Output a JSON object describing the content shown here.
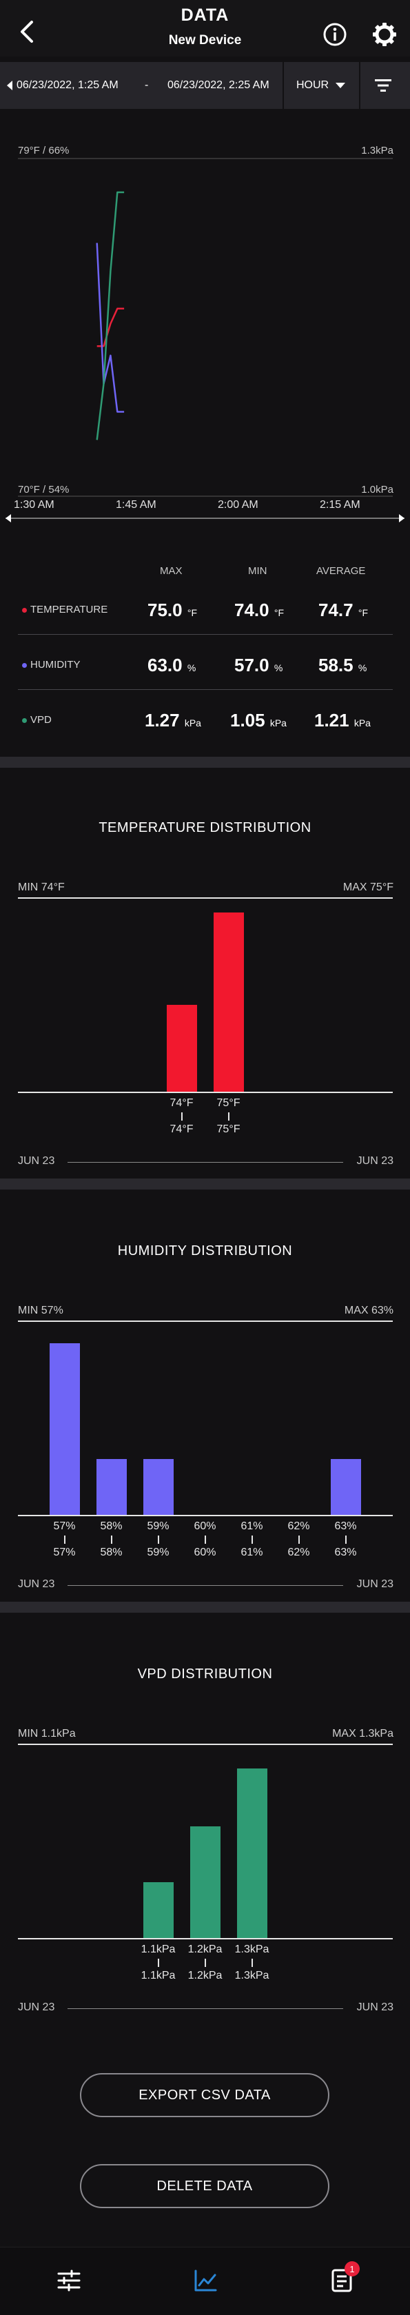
{
  "header": {
    "title": "DATA",
    "subtitle": "New Device",
    "back_icon": "chevron-left-icon",
    "info_icon": "info-icon",
    "settings_icon": "gear-icon"
  },
  "range": {
    "start": "06/23/2022, 1:25 AM",
    "dash": "-",
    "end": "06/23/2022, 2:25 AM",
    "unit": "HOUR"
  },
  "chart": {
    "left_top": "79°F / 66%",
    "left_bottom": "70°F / 54%",
    "right_top": "1.3kPa",
    "right_bottom": "1.0kPa",
    "time_labels": [
      "1:30 AM",
      "1:45 AM",
      "2:00 AM",
      "2:15 AM"
    ]
  },
  "chart_data": {
    "type": "line",
    "x_ticks": [
      "1:30 AM",
      "1:45 AM",
      "2:00 AM",
      "2:15 AM"
    ],
    "left_axis": {
      "top": "79°F / 66%",
      "bottom": "70°F / 54%"
    },
    "right_axis": {
      "top": "1.3kPa",
      "bottom": "1.0kPa"
    },
    "series": [
      {
        "name": "TEMPERATURE",
        "color": "#e8213a",
        "x": [
          "1:40 AM",
          "1:41 AM",
          "1:42 AM",
          "1:43 AM",
          "1:44 AM"
        ],
        "y": [
          74.0,
          74.0,
          74.6,
          75.0,
          75.0
        ]
      },
      {
        "name": "HUMIDITY",
        "color": "#6f65f6",
        "x": [
          "1:40 AM",
          "1:41 AM",
          "1:42 AM",
          "1:43 AM",
          "1:44 AM"
        ],
        "y": [
          63.0,
          58.0,
          59.0,
          57.0,
          57.0
        ]
      },
      {
        "name": "VPD",
        "color": "#2f9b74",
        "x": [
          "1:40 AM",
          "1:41 AM",
          "1:42 AM",
          "1:43 AM",
          "1:44 AM"
        ],
        "y": [
          1.05,
          1.1,
          1.2,
          1.27,
          1.27
        ]
      }
    ]
  },
  "stats": {
    "headers": {
      "max": "MAX",
      "min": "MIN",
      "avg": "AVERAGE"
    },
    "rows": [
      {
        "label": "TEMPERATURE",
        "color": "#e8213a",
        "max": "75.0",
        "min": "74.0",
        "avg": "74.7",
        "unit": "°F"
      },
      {
        "label": "HUMIDITY",
        "color": "#6f65f6",
        "max": "63.0",
        "min": "57.0",
        "avg": "58.5",
        "unit": "%"
      },
      {
        "label": "VPD",
        "color": "#2f9b74",
        "max": "1.27",
        "min": "1.05",
        "avg": "1.21",
        "unit": "kPa"
      }
    ]
  },
  "distributions": [
    {
      "title": "TEMPERATURE DISTRIBUTION",
      "min": "MIN 74°F",
      "max": "MAX 75°F",
      "color": "#f2182e",
      "bins": [
        {
          "top": "74°F",
          "bottom": "74°F",
          "value": 0.45
        },
        {
          "top": "75°F",
          "bottom": "75°F",
          "value": 0.93
        }
      ],
      "date_start": "JUN 23",
      "date_end": "JUN 23"
    },
    {
      "title": "HUMIDITY DISTRIBUTION",
      "min": "MIN 57%",
      "max": "MAX 63%",
      "color": "#6f65f6",
      "bins": [
        {
          "top": "57%",
          "bottom": "57%",
          "value": 0.89
        },
        {
          "top": "58%",
          "bottom": "58%",
          "value": 0.29
        },
        {
          "top": "59%",
          "bottom": "59%",
          "value": 0.29
        },
        {
          "top": "60%",
          "bottom": "60%",
          "value": 0
        },
        {
          "top": "61%",
          "bottom": "61%",
          "value": 0
        },
        {
          "top": "62%",
          "bottom": "62%",
          "value": 0
        },
        {
          "top": "63%",
          "bottom": "63%",
          "value": 0.29
        }
      ],
      "date_start": "JUN 23",
      "date_end": "JUN 23"
    },
    {
      "title": "VPD DISTRIBUTION",
      "min": "MIN 1.1kPa",
      "max": "MAX 1.3kPa",
      "color": "#2f9b74",
      "bins": [
        {
          "top": "1.1kPa",
          "bottom": "1.1kPa",
          "value": 0.29
        },
        {
          "top": "1.2kPa",
          "bottom": "1.2kPa",
          "value": 0.58
        },
        {
          "top": "1.3kPa",
          "bottom": "1.3kPa",
          "value": 0.88
        }
      ],
      "date_start": "JUN 23",
      "date_end": "JUN 23"
    }
  ],
  "buttons": {
    "export": "EXPORT CSV DATA",
    "delete": "DELETE DATA"
  },
  "nav": {
    "settings_icon": "sliders-icon",
    "chart_icon": "chart-line-icon",
    "log_icon": "notes-icon",
    "badge": "1",
    "accent": "#2a86d6"
  }
}
